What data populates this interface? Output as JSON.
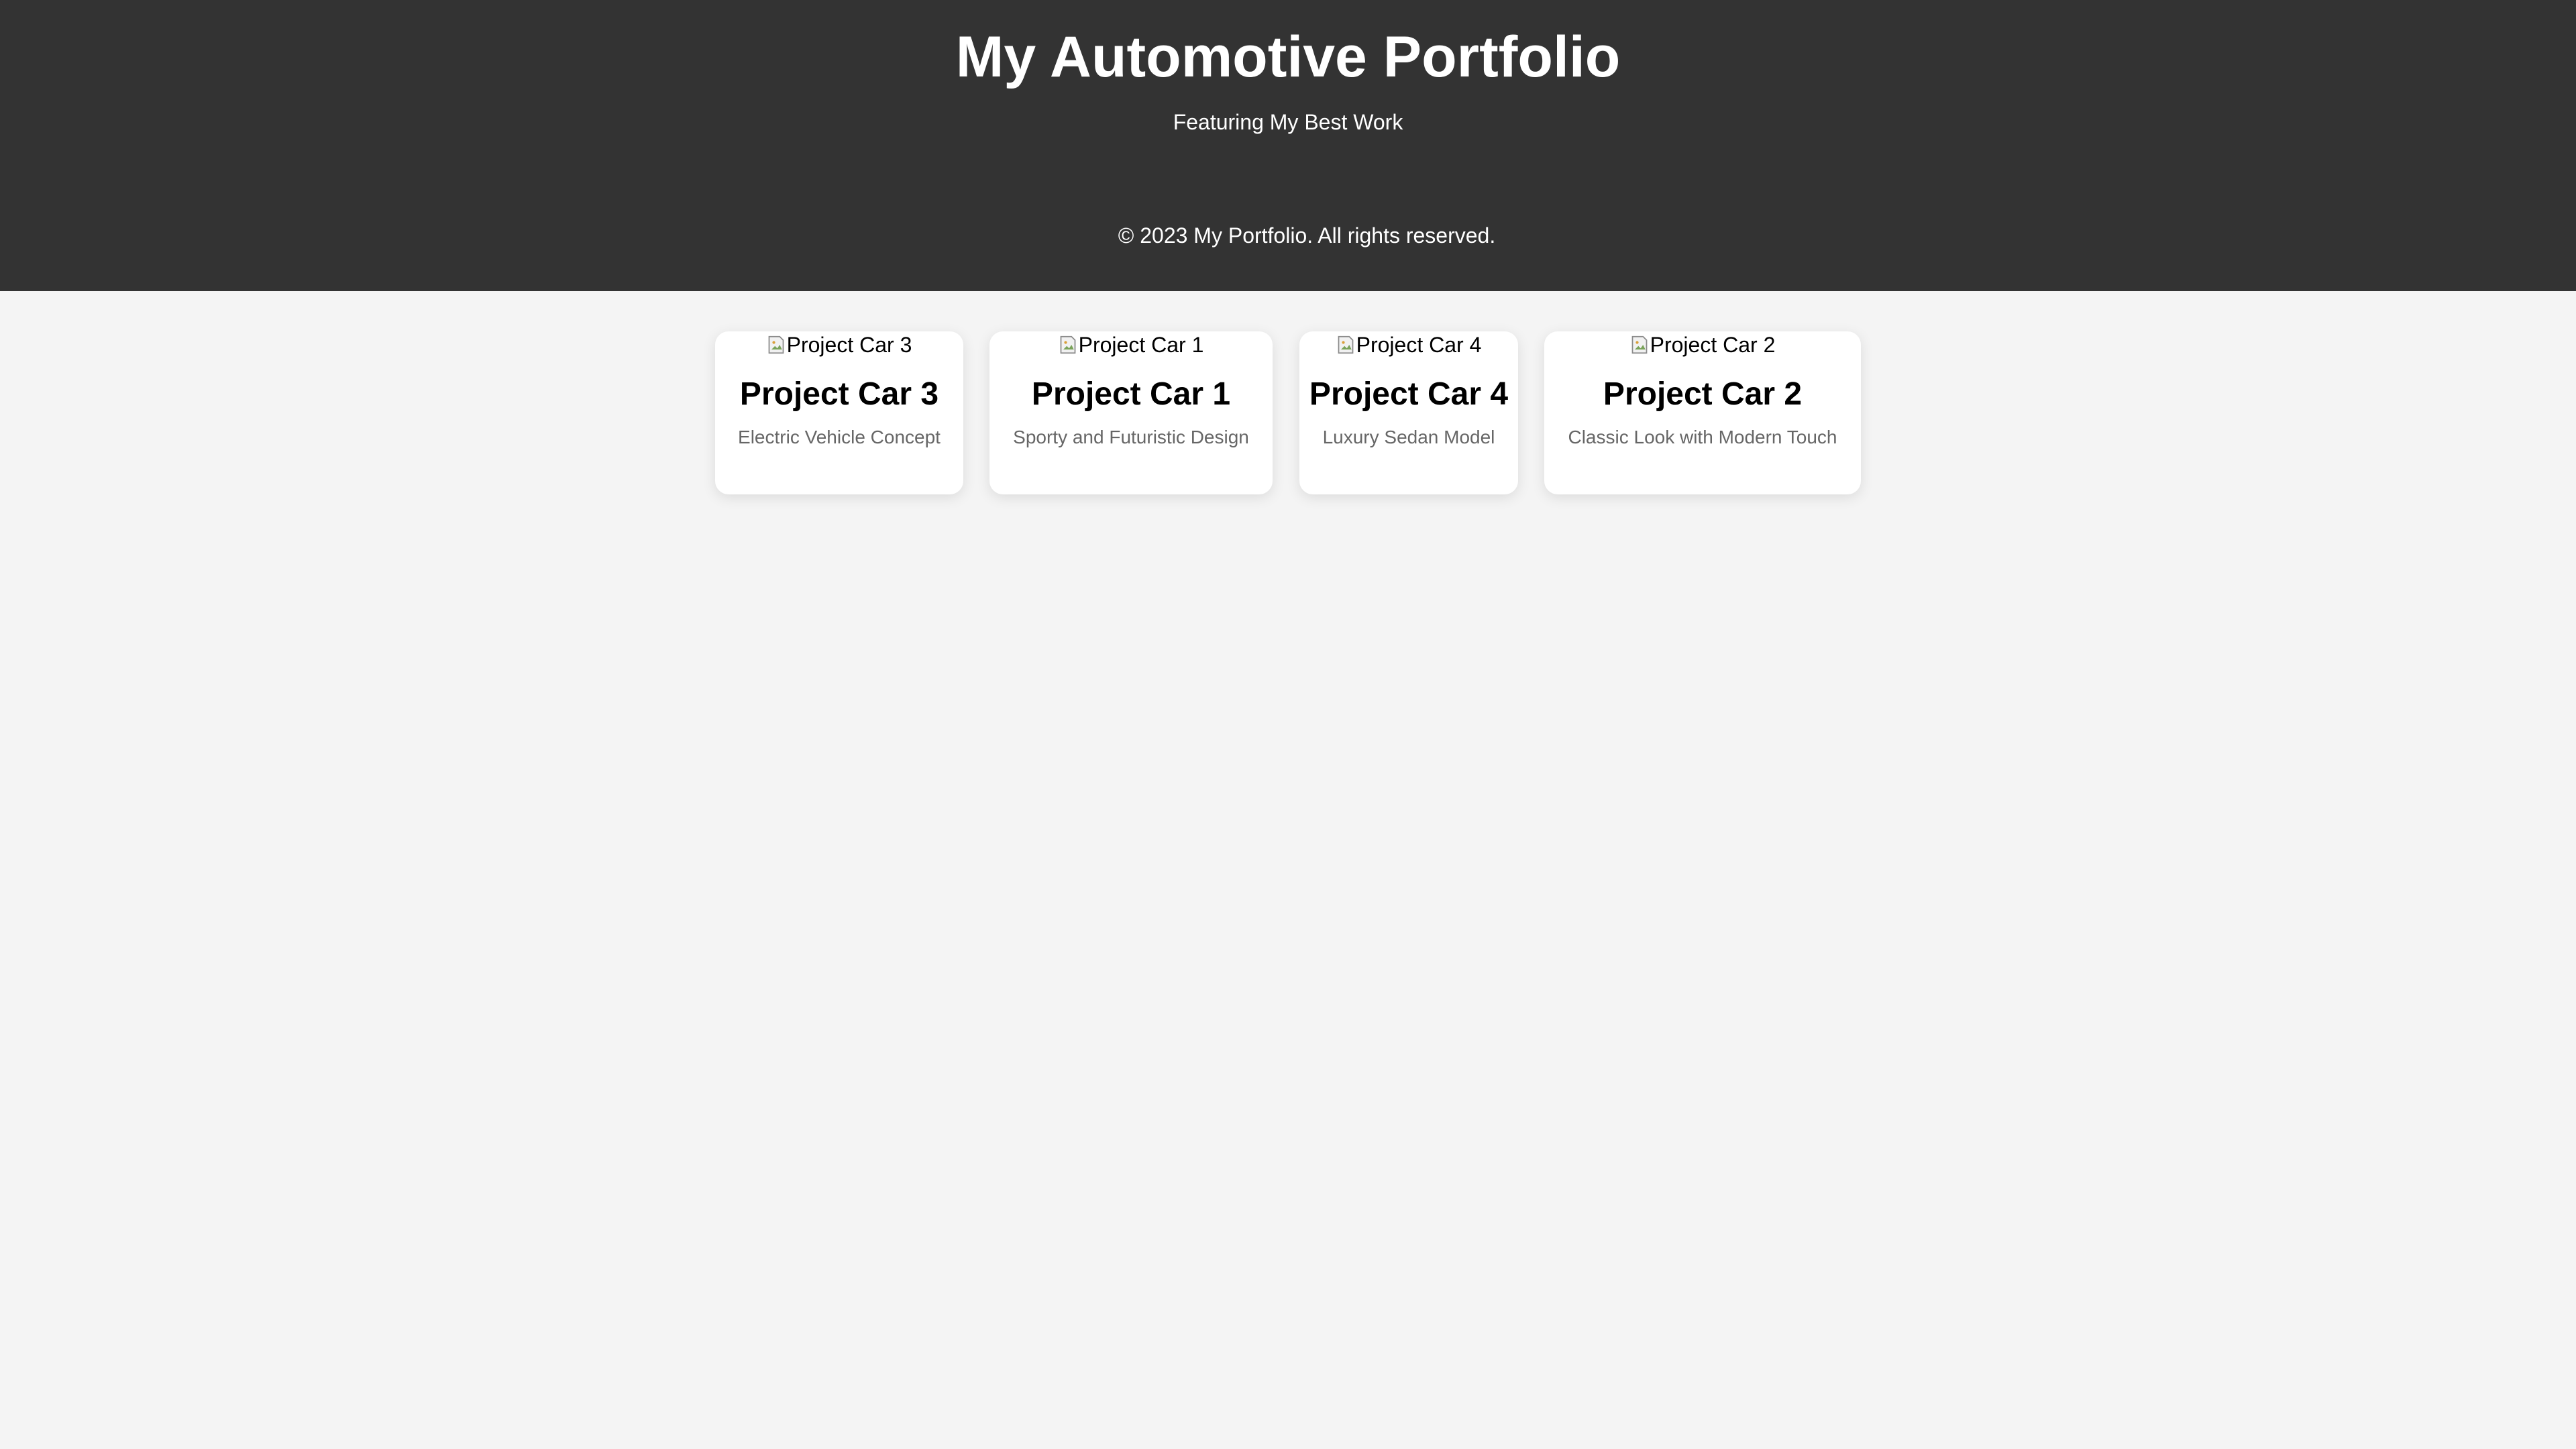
{
  "header": {
    "title": "My Automotive Portfolio",
    "subtitle": "Featuring My Best Work",
    "copyright": "© 2023 My Portfolio. All rights reserved."
  },
  "projects": [
    {
      "image_alt": "Project Car 3",
      "title": "Project Car 3",
      "description": "Electric Vehicle Concept"
    },
    {
      "image_alt": "Project Car 1",
      "title": "Project Car 1",
      "description": "Sporty and Futuristic Design"
    },
    {
      "image_alt": "Project Car 4",
      "title": "Project Car 4",
      "description": "Luxury Sedan Model"
    },
    {
      "image_alt": "Project Car 2",
      "title": "Project Car 2",
      "description": "Classic Look with Modern Touch"
    }
  ],
  "colors": {
    "header_background": "#333333",
    "page_background": "#f4f4f4",
    "card_background": "#ffffff",
    "description_text": "#666666"
  }
}
